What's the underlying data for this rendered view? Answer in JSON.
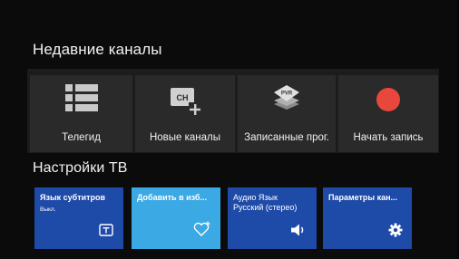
{
  "recent": {
    "title": "Недавние каналы",
    "tiles": [
      {
        "label": "Телегид",
        "icon": "list-icon"
      },
      {
        "label": "Новые каналы",
        "icon": "channel-add-icon"
      },
      {
        "label": "Записанные прог.",
        "icon": "pvr-icon"
      },
      {
        "label": "Начать запись",
        "icon": "record-icon"
      }
    ]
  },
  "settings": {
    "title": "Настройки ТВ",
    "tiles": [
      {
        "title": "Язык субтитров",
        "sub": "Выкл.",
        "icon": "subtitle-icon",
        "color": "#1e4aa8"
      },
      {
        "title": "Добавить в изб...",
        "sub": "",
        "icon": "heart-add-icon",
        "color": "#3aa9e4"
      },
      {
        "title": "Аудио Язык",
        "sub": "Русский (стерео)",
        "icon": "speaker-icon",
        "color": "#1e4aa8"
      },
      {
        "title": "Параметры кан...",
        "sub": "",
        "icon": "gear-icon",
        "color": "#1e4aa8"
      }
    ]
  },
  "colors": {
    "record": "#e8473b",
    "accent_blue": "#1e4aa8",
    "accent_light_blue": "#3aa9e4"
  }
}
